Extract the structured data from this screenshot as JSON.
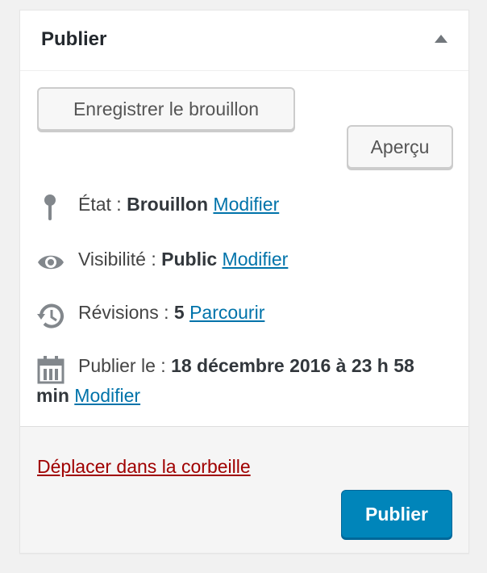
{
  "header": {
    "title": "Publier"
  },
  "actions": {
    "save_draft": "Enregistrer le brouillon",
    "preview": "Aperçu"
  },
  "status": {
    "label": "État :",
    "value": "Brouillon",
    "link": "Modifier",
    "icon": "pin-icon"
  },
  "visibility": {
    "label": "Visibilité :",
    "value": "Public",
    "link": "Modifier",
    "icon": "eye-icon"
  },
  "revisions": {
    "label": "Révisions :",
    "value": "5",
    "link": "Parcourir",
    "icon": "history-icon"
  },
  "schedule": {
    "label": "Publier le :",
    "value": "18 décembre 2016 à 23 h 58 min",
    "link": "Modifier",
    "icon": "calendar-icon"
  },
  "footer": {
    "trash": "Déplacer dans la corbeille",
    "publish": "Publier"
  },
  "colors": {
    "link": "#0073aa",
    "trash": "#a00000",
    "primary": "#0085ba"
  }
}
